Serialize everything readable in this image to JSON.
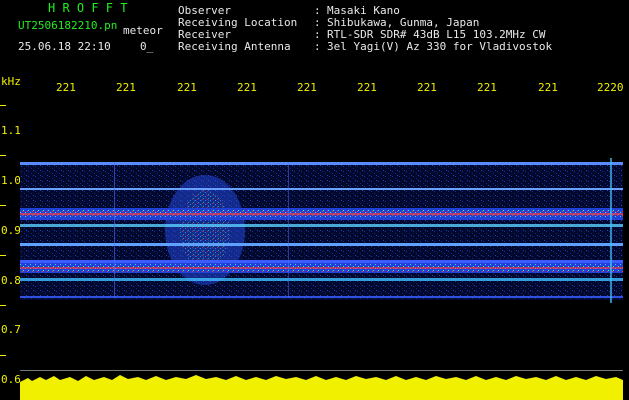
{
  "header": {
    "program_title": "H R O F F T",
    "filename": "UT2506182210.pn",
    "mode_label": "meteor",
    "datetime": "25.06.18 22:10",
    "counter": "0_"
  },
  "info": {
    "labels": [
      "Observer",
      "Receiving Location",
      "Receiver",
      "Receiving Antenna"
    ],
    "separator": ":",
    "values": [
      "Masaki Kano",
      "Shibukawa, Gunma, Japan",
      "RTL-SDR SDR# 43dB L15 103.2MHz CW",
      "3el Yagi(V) Az 330 for Vladivostok"
    ]
  },
  "time_axis": {
    "labels": [
      "221",
      "221",
      "221",
      "221",
      "221",
      "221",
      "221",
      "221",
      "221",
      "2220"
    ]
  },
  "freq_axis": {
    "unit": "kHz",
    "labels": [
      "1.1",
      "1.0",
      "0.9",
      "0.8",
      "0.7",
      "0.6"
    ]
  },
  "colors": {
    "text_green": "#22ee22",
    "text_white": "#e8e8e8",
    "axis_yellow": "#f0f000",
    "signal_blue": "#1a2cc8",
    "signal_red": "#ff2020"
  },
  "spectrogram": {
    "bands_khz": [
      1.02,
      0.985,
      0.935,
      0.915,
      0.865,
      0.83,
      0.81,
      0.765
    ],
    "strong_bands_khz": [
      0.925,
      0.82
    ]
  }
}
